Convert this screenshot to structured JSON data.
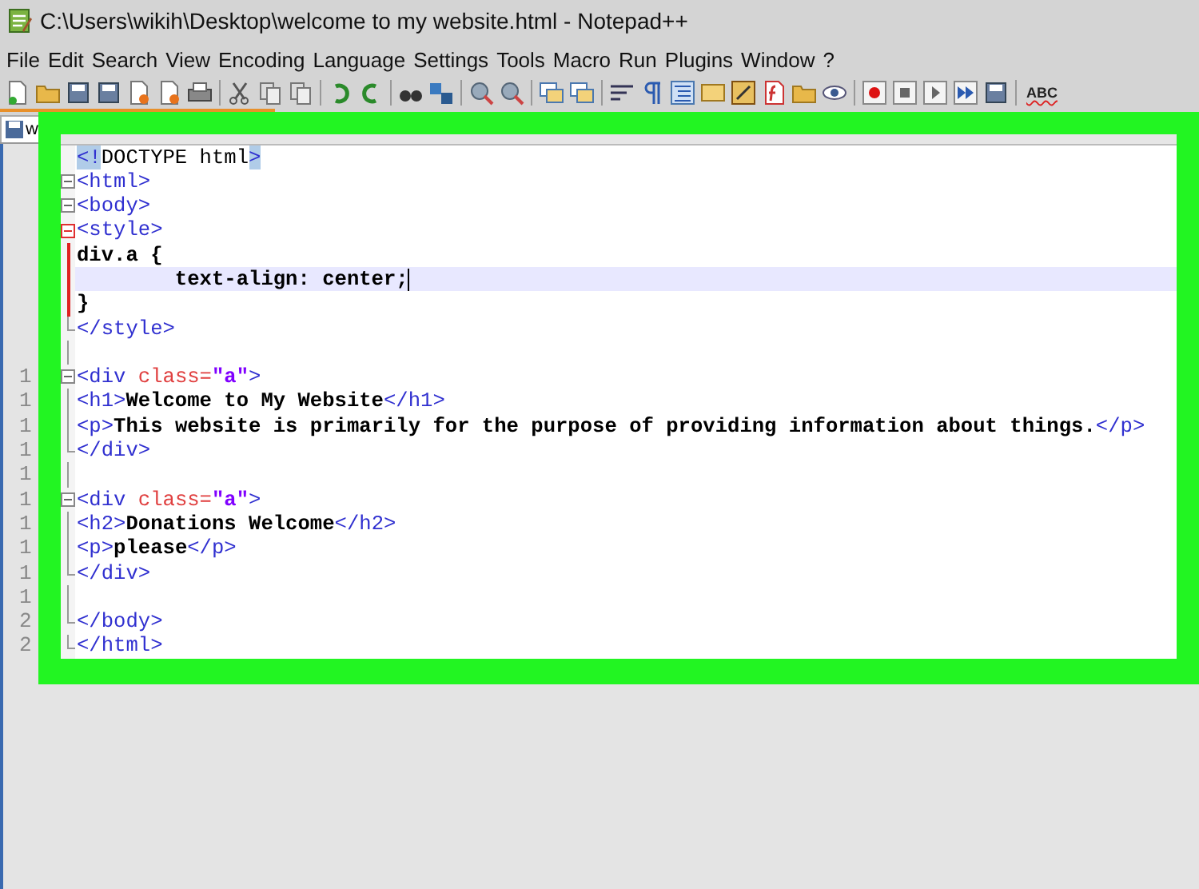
{
  "window": {
    "title": "C:\\Users\\wikih\\Desktop\\welcome to my website.html - Notepad++"
  },
  "menu": [
    "File",
    "Edit",
    "Search",
    "View",
    "Encoding",
    "Language",
    "Settings",
    "Tools",
    "Macro",
    "Run",
    "Plugins",
    "Window",
    "?"
  ],
  "toolbar": {
    "spell_check_label": "ABC"
  },
  "tabs": [
    {
      "label": "w",
      "selected": true
    }
  ],
  "editor": {
    "lines": [
      {
        "kind": "plain",
        "current": false,
        "tokens": [
          {
            "kind": "match",
            "text": "<!"
          },
          {
            "kind": "plain",
            "text": "DOCTYPE html"
          },
          {
            "kind": "match",
            "text": ">"
          }
        ]
      },
      {
        "kind": "start",
        "current": false,
        "tokens": [
          {
            "kind": "tag",
            "text": "<html>"
          }
        ]
      },
      {
        "kind": "start",
        "current": false,
        "tokens": [
          {
            "kind": "tag",
            "text": "<body>"
          }
        ]
      },
      {
        "kind": "start",
        "current_block": true,
        "current": false,
        "tokens": [
          {
            "kind": "tag",
            "text": "<style>"
          }
        ]
      },
      {
        "kind": "middle",
        "current_block": true,
        "current": false,
        "tokens": [
          {
            "kind": "text",
            "text": "div.a {"
          }
        ]
      },
      {
        "kind": "middle",
        "current_block": true,
        "current": true,
        "tokens": [
          {
            "kind": "text",
            "text": "        text-align: center;"
          }
        ]
      },
      {
        "kind": "middle",
        "current_block": true,
        "current": false,
        "tokens": [
          {
            "kind": "text",
            "text": "}"
          }
        ]
      },
      {
        "kind": "end",
        "current": false,
        "tokens": [
          {
            "kind": "tag",
            "text": "</style>"
          }
        ]
      },
      {
        "kind": "middle",
        "current": false
      },
      {
        "number": "1",
        "kind": "start",
        "current": false,
        "tokens": [
          {
            "kind": "tag",
            "text": "<div "
          },
          {
            "kind": "attr",
            "text": "class="
          },
          {
            "kind": "string",
            "text": "\"a\""
          },
          {
            "kind": "tag",
            "text": ">"
          }
        ]
      },
      {
        "number": "1",
        "kind": "middle",
        "current": false,
        "tokens": [
          {
            "kind": "tag",
            "text": "<h1>"
          },
          {
            "kind": "text",
            "text": "Welcome to My Website"
          },
          {
            "kind": "tag",
            "text": "</h1>"
          }
        ]
      },
      {
        "number": "1",
        "kind": "middle",
        "current": false,
        "tokens": [
          {
            "kind": "tag",
            "text": "<p>"
          },
          {
            "kind": "text",
            "text": "This website is primarily for the purpose of providing information about things."
          },
          {
            "kind": "tag",
            "text": "</p>"
          }
        ]
      },
      {
        "number": "1",
        "kind": "end",
        "current": false,
        "tokens": [
          {
            "kind": "tag",
            "text": "</div>"
          }
        ]
      },
      {
        "number": "1",
        "kind": "middle",
        "current": false
      },
      {
        "number": "1",
        "kind": "start",
        "current": false,
        "tokens": [
          {
            "kind": "tag",
            "text": "<div "
          },
          {
            "kind": "attr",
            "text": "class="
          },
          {
            "kind": "string",
            "text": "\"a\""
          },
          {
            "kind": "tag",
            "text": ">"
          }
        ]
      },
      {
        "number": "1",
        "kind": "middle",
        "current": false,
        "tokens": [
          {
            "kind": "tag",
            "text": "<h2>"
          },
          {
            "kind": "text",
            "text": "Donations Welcome"
          },
          {
            "kind": "tag",
            "text": "</h2>"
          }
        ]
      },
      {
        "number": "1",
        "kind": "middle",
        "current": false,
        "tokens": [
          {
            "kind": "tag",
            "text": "<p>"
          },
          {
            "kind": "text",
            "text": "please"
          },
          {
            "kind": "tag",
            "text": "</p>"
          }
        ]
      },
      {
        "number": "1",
        "kind": "end",
        "current": false,
        "tokens": [
          {
            "kind": "tag",
            "text": "</div>"
          }
        ]
      },
      {
        "number": "1",
        "kind": "middle",
        "current": false
      },
      {
        "number": "2",
        "kind": "end",
        "current": false,
        "tokens": [
          {
            "kind": "tag",
            "text": "</body>"
          }
        ]
      },
      {
        "number": "2",
        "kind": "end",
        "current": false,
        "tokens": [
          {
            "kind": "tag",
            "text": "</html>"
          }
        ]
      }
    ]
  }
}
